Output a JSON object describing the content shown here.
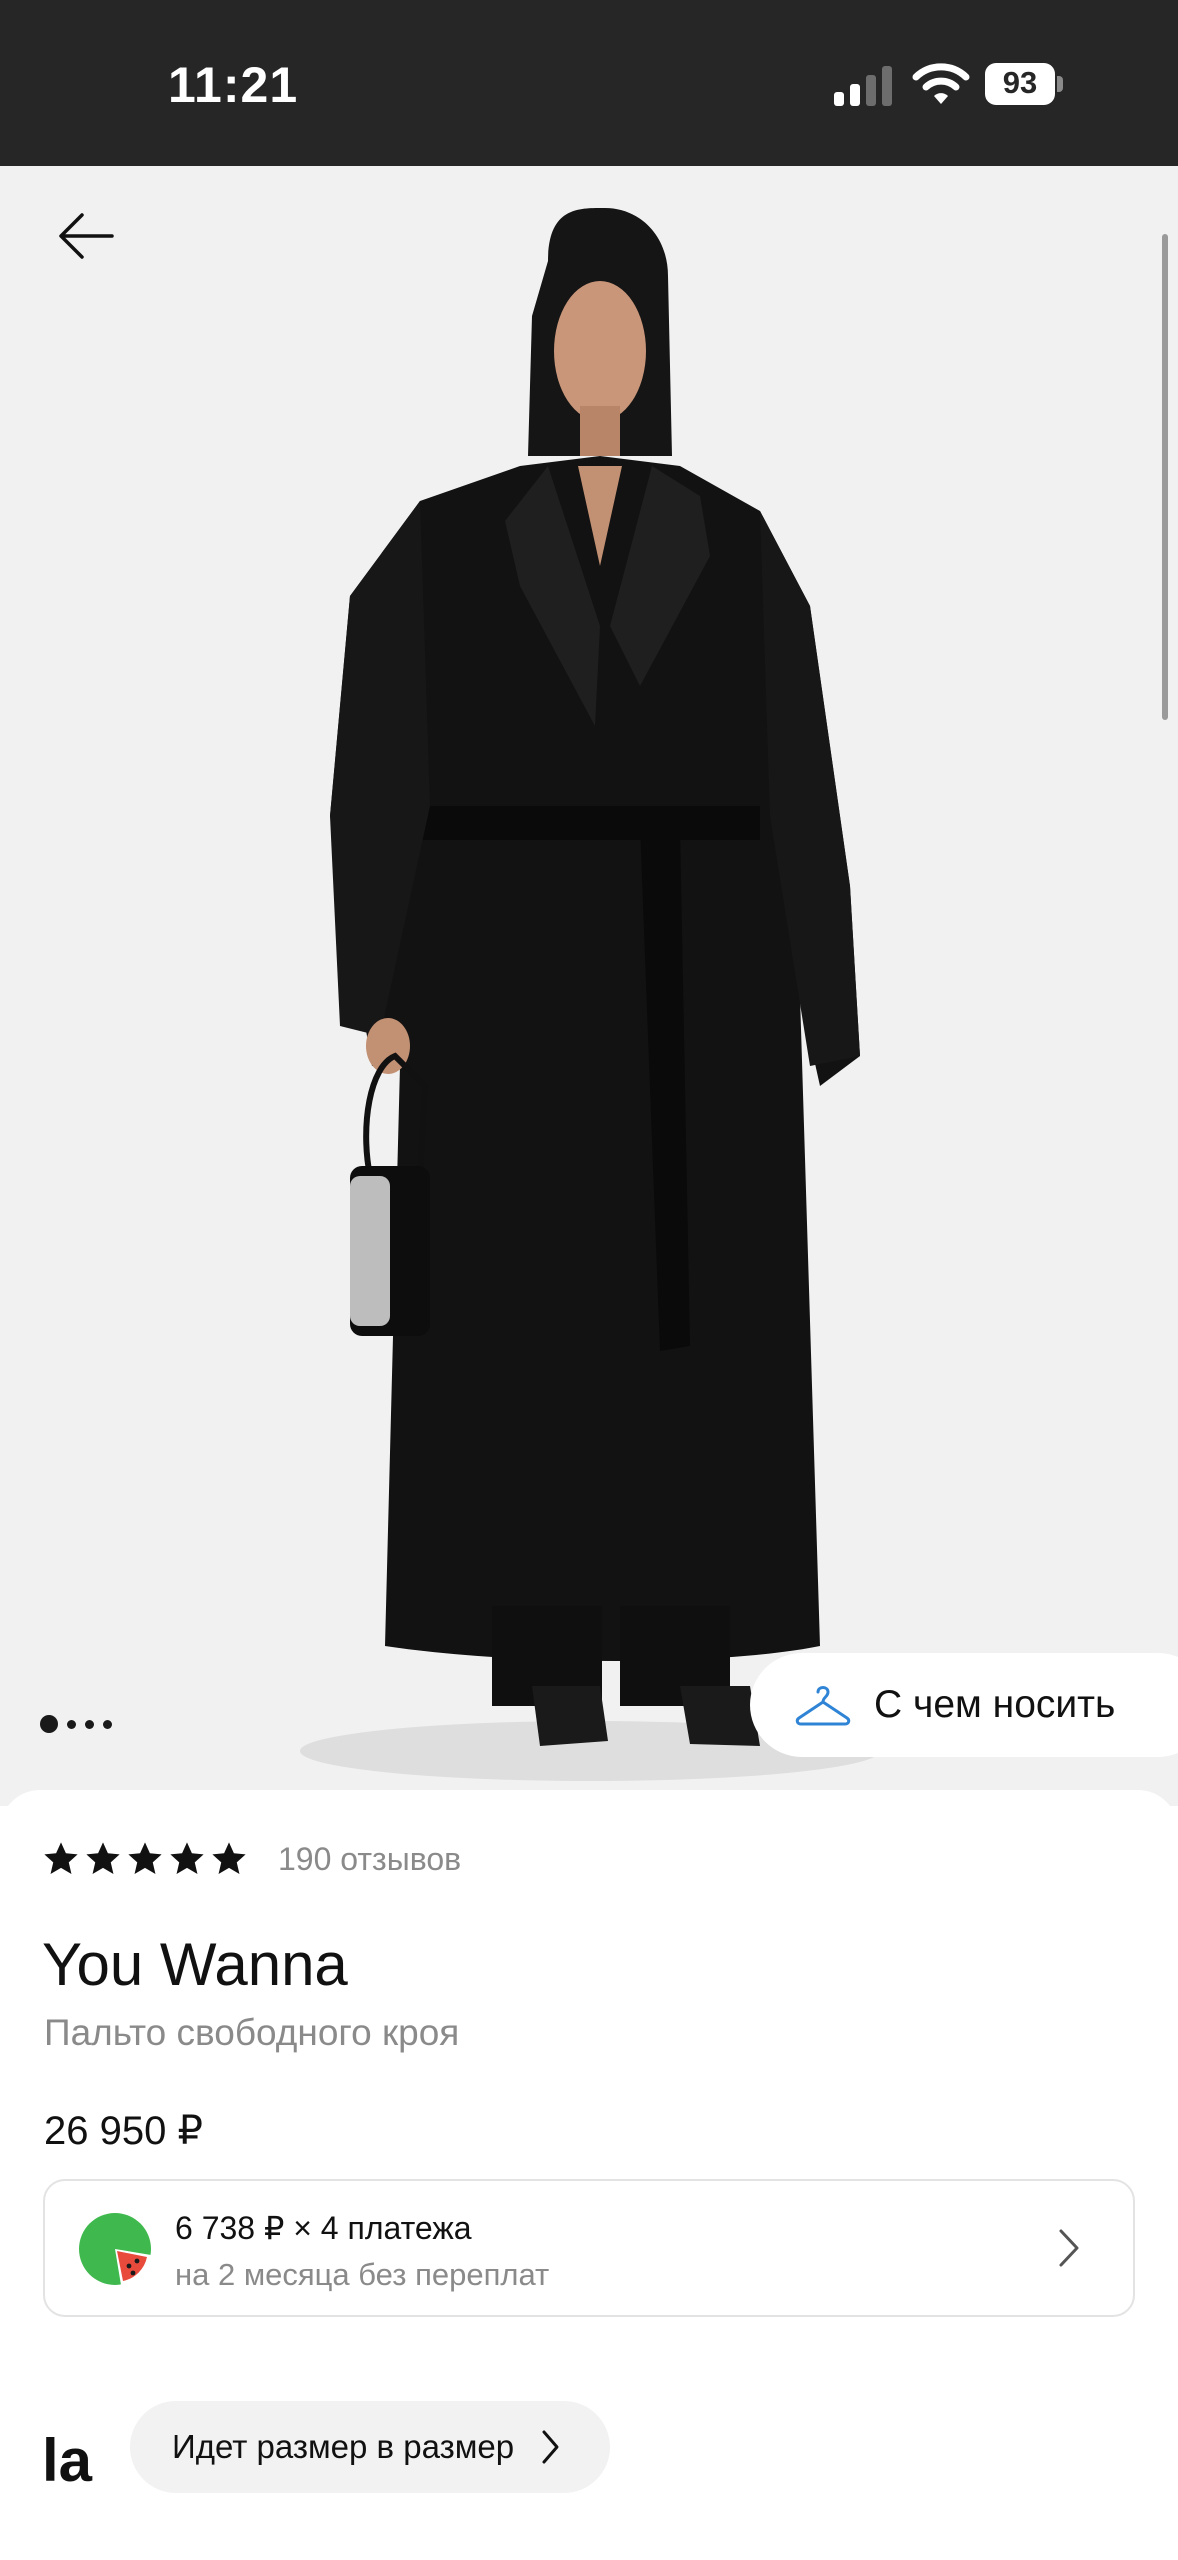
{
  "status_bar": {
    "time": "11:21",
    "battery": "93"
  },
  "gallery": {
    "icons": [
      "arrow-left-icon",
      "hanger-icon"
    ],
    "pager": {
      "count": 4,
      "active_index": 0
    },
    "wear_button_label": "С чем носить"
  },
  "product": {
    "rating": 5,
    "reviews": "190 отзывов",
    "brand": "You Wanna",
    "subtitle": "Пальто свободного кроя",
    "price": "26 950 ₽"
  },
  "installment": {
    "title": "6 738 ₽ × 4 платежа",
    "subtitle": "на 2 месяца без переплат",
    "icon": "watermelon-icon"
  },
  "bottom": {
    "logo": "la",
    "size_hint": "Идет размер в размер"
  },
  "colors": {
    "status_bar_bg": "#262626",
    "photo_bg": "#f1f1f2",
    "muted_text": "#8a8a8a",
    "melon_green": "#3fb94e",
    "melon_red": "#e84a3c"
  }
}
